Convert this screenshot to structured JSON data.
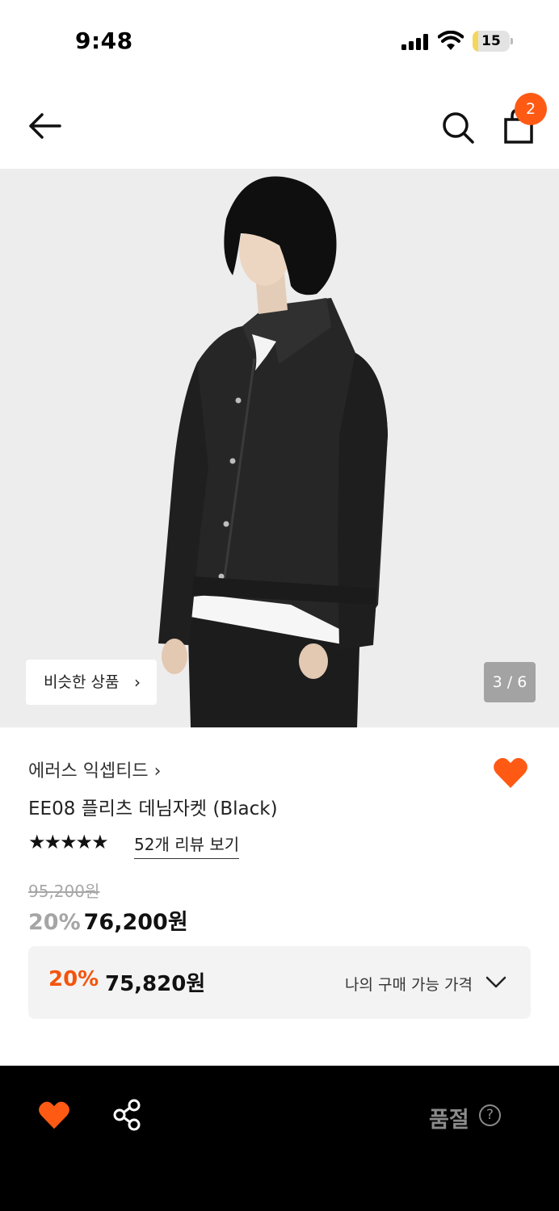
{
  "status_bar": {
    "time": "9:48",
    "battery_level": "15"
  },
  "header": {
    "cart_count": "2"
  },
  "gallery": {
    "similar_label": "비슷한 상품",
    "counter": "3 / 6"
  },
  "product": {
    "brand": "에러스 익셉티드 ›",
    "name": "EE08 플리츠 데님자켓 (Black)",
    "rating_stars": 5,
    "review_link": "52개 리뷰 보기",
    "original_price": "95,200원",
    "sale_rate": "20%",
    "sale_price": "76,200원",
    "my_price": {
      "rate": "20%",
      "amount": "75,820원",
      "label": "나의 구매 가능 가격"
    }
  },
  "bottom_bar": {
    "status": "품절",
    "help_symbol": "?"
  },
  "colors": {
    "accent": "#ff5a14",
    "sale_red": "#f3550c",
    "bar_bg": "#000000"
  },
  "icons": [
    "back-arrow-icon",
    "search-icon",
    "shopping-bag-icon",
    "heart-icon",
    "share-icon",
    "chevron-down-icon",
    "help-circle-icon"
  ]
}
